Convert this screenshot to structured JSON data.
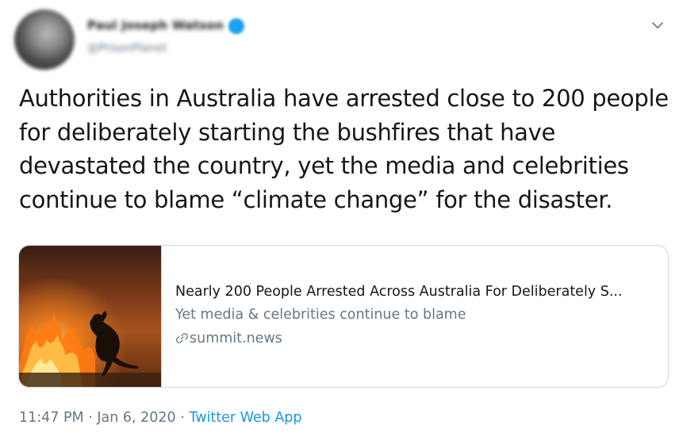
{
  "header": {
    "display_name": "Paul Joseph Watson",
    "handle": "@PrisonPlanet",
    "verified_color": "#1da1f2"
  },
  "tweet": {
    "text": "Authorities in Australia have arrested close to 200 people for deliberately starting the bushfires that have devastated the country, yet the media and celebrities continue to blame “climate change” for the disaster."
  },
  "card": {
    "title": "Nearly 200 People Arrested Across Australia For Deliberately S...",
    "description": "Yet media & celebrities continue to blame",
    "domain": "summit.news",
    "image_icon": "kangaroo-bushfire-photo",
    "link_icon": "link-icon"
  },
  "footer": {
    "time": "11:47 PM",
    "separator1": " · ",
    "date": "Jan 6, 2020",
    "separator2": " · ",
    "source": "Twitter Web App"
  },
  "colors": {
    "text": "#14171a",
    "secondary": "#657786",
    "link": "#1b95e0",
    "border": "#ccd6dd"
  }
}
